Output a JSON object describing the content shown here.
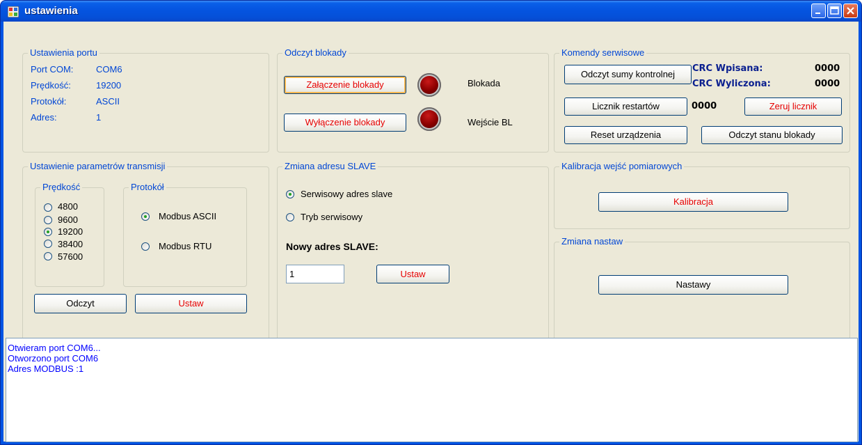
{
  "window": {
    "title": "ustawienia"
  },
  "port_settings": {
    "title": "Ustawienia portu",
    "rows": [
      {
        "label": "Port COM:",
        "value": "COM6"
      },
      {
        "label": "Prędkość:",
        "value": "19200"
      },
      {
        "label": "Protokół:",
        "value": "ASCII"
      },
      {
        "label": "Adres:",
        "value": "1"
      }
    ]
  },
  "lock_read": {
    "title": "Odczyt blokady",
    "enable_button": "Załączenie blokady",
    "disable_button": "Wyłączenie blokady",
    "indicator1_label": "Blokada",
    "indicator2_label": "Wejście BL"
  },
  "service": {
    "title": "Komendy serwisowe",
    "checksum_button": "Odczyt sumy kontrolnej",
    "crc_entered_label": "CRC Wpisana:",
    "crc_entered_value": "0000",
    "crc_computed_label": "CRC Wyliczona:",
    "crc_computed_value": "0000",
    "restart_counter_button": "Licznik restartów",
    "restart_counter_value": "0000",
    "reset_counter_button": "Zeruj licznik",
    "reset_device_button": "Reset urządzenia",
    "read_lock_state_button": "Odczyt stanu blokady"
  },
  "transmission": {
    "title": "Ustawienie parametrów transmisji",
    "speed_title": "Prędkość",
    "speeds": [
      "4800",
      "9600",
      "19200",
      "38400",
      "57600"
    ],
    "selected_speed": "19200",
    "protocol_title": "Protokół",
    "protocols": [
      "Modbus ASCII",
      "Modbus RTU"
    ],
    "selected_protocol": "Modbus ASCII",
    "read_button": "Odczyt",
    "set_button": "Ustaw"
  },
  "slave": {
    "title": "Zmiana adresu SLAVE",
    "options": [
      "Serwisowy adres slave",
      "Tryb serwisowy"
    ],
    "selected_option": "Serwisowy adres slave",
    "new_address_label": "Nowy adres SLAVE:",
    "new_address_value": "1",
    "set_button": "Ustaw"
  },
  "calibration": {
    "title": "Kalibracja wejść pomiarowych",
    "button": "Kalibracja"
  },
  "settings_change": {
    "title": "Zmiana nastaw",
    "button": "Nastawy"
  },
  "log": {
    "lines": [
      "Otwieram port COM6...",
      "Otworzono port COM6",
      "Adres MODBUS :1"
    ]
  },
  "colors": {
    "label_blue": "#0046d5",
    "button_red_text": "#e60000",
    "client_bg": "#ece9d8",
    "log_text": "#0000ff"
  }
}
